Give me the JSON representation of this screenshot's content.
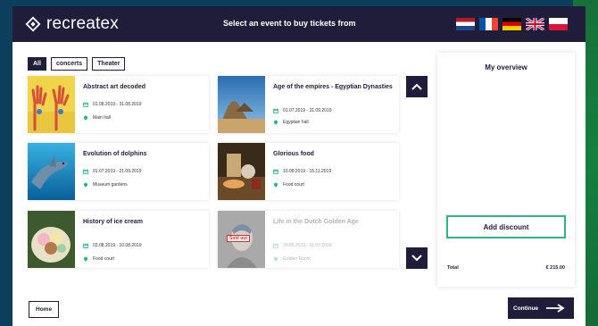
{
  "header": {
    "logo_text": "recreatex",
    "title": "Select an event to buy tickets from",
    "flags": [
      "dutch-flag",
      "french-flag",
      "german-flag",
      "uk-flag",
      "polish-flag"
    ]
  },
  "filters": [
    {
      "label": "All",
      "active": true
    },
    {
      "label": "concerts",
      "active": false
    },
    {
      "label": "Theater",
      "active": false
    }
  ],
  "events": [
    {
      "title": "Abstract art decoded",
      "dates": "01.08.2019 - 31.08.2019",
      "location": "Main hall"
    },
    {
      "title": "Age of the empires - Egyptian Dynasties",
      "dates": "01.07.2019 - 31.09.2019",
      "location": "Egyptian hall"
    },
    {
      "title": "Evolution of dolphins",
      "dates": "01.07.2019 - 21.09.2019",
      "location": "Museum gardens"
    },
    {
      "title": "Glorious food",
      "dates": "10.06.2019 - 15.11.2019",
      "location": "Food court"
    },
    {
      "title": "History of ice cream",
      "dates": "03.08.2019 - 10.08.2019",
      "location": "Food court"
    },
    {
      "title": "Life in the Dutch Golden Age",
      "dates": "20.05.2019 - 31.07.2019",
      "location": "Golden Room",
      "badge": "Sold out",
      "sold_out": true
    }
  ],
  "overview": {
    "title": "My overview",
    "discount_label": "Add discount",
    "total_label": "Total",
    "total_value": "€ 215.00"
  },
  "footer": {
    "home_label": "Home",
    "continue_label": "Continue"
  },
  "colors": {
    "navy": "#1f1d3a",
    "accent_green": "#2fb38a",
    "backdrop": "#0c3f5c"
  }
}
